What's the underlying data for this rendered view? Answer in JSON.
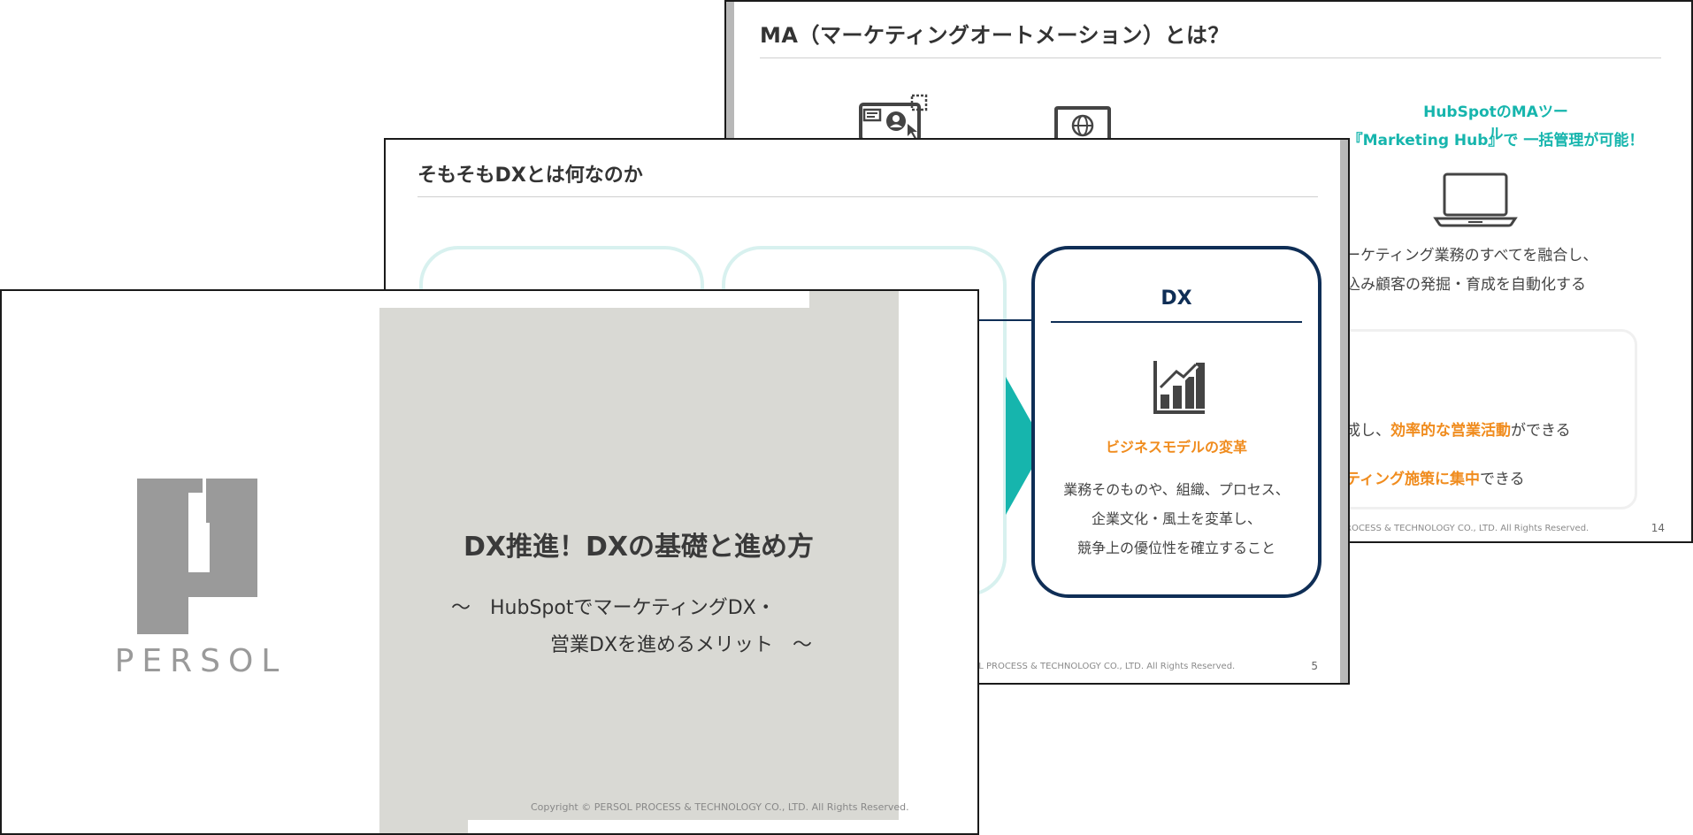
{
  "slide_back": {
    "title": "MA（マーケティングオートメーション）とは？",
    "hubspot_line1": "HubSpotのMAツール",
    "hubspot_line2": "『Marketing Hub』で 一括管理が可能！",
    "desc_line1": "ーケティング業務のすべてを融合し、",
    "desc_line2": "込み顧客の発掘・育成を自動化する",
    "benefit1_pre": "成し、",
    "benefit1_accent": "効率的な営業活動",
    "benefit1_post": "ができる",
    "benefit2_accent": "ティング施策に集中",
    "benefit2_post": "できる",
    "copyright": "ROCESS & TECHNOLOGY CO., LTD. All Rights Reserved.",
    "page_number": "14",
    "accent_color": "#16b5ad",
    "highlight_color": "#f08c1e"
  },
  "slide_middle": {
    "title": "そもそもDXとは何なのか",
    "dx_card": {
      "title": "DX",
      "subtitle": "ビジネスモデルの変革",
      "body_line1": "業務そのものや、組織、プロセス、",
      "body_line2": "企業文化・風土を変革し、",
      "body_line3": "競争上の優位性を確立すること"
    },
    "copyright": "SOL PROCESS & TECHNOLOGY CO., LTD. All Rights Reserved.",
    "page_number": "5",
    "card_color": "#0f2e56",
    "arrow_color": "#16b5ad"
  },
  "slide_front": {
    "logo_text": "PERSOL",
    "title": "DX推進！DXの基礎と進め方",
    "subtitle_line1": "～　HubSpotでマーケティングDX・",
    "subtitle_line2": "営業DXを進めるメリット　～",
    "copyright": "Copyright © PERSOL PROCESS & TECHNOLOGY CO., LTD. All Rights Reserved."
  }
}
